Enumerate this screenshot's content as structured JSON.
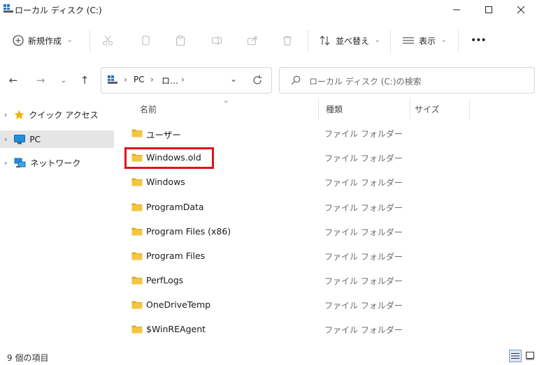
{
  "window": {
    "title": "ローカル ディスク (C:)"
  },
  "toolbar": {
    "new_label": "新規作成",
    "sort_label": "並べ替え",
    "view_label": "表示",
    "more_label": "•••"
  },
  "address": {
    "segments": [
      "PC",
      "ロ…"
    ]
  },
  "search": {
    "placeholder": "ローカル ディスク (C:)の検索"
  },
  "nav": {
    "items": [
      {
        "label": "クイック アクセス",
        "icon": "star-icon"
      },
      {
        "label": "PC",
        "icon": "pc-icon",
        "selected": true
      },
      {
        "label": "ネットワーク",
        "icon": "network-icon"
      }
    ]
  },
  "columns": {
    "name": "名前",
    "type": "種類",
    "size": "サイズ"
  },
  "files": [
    {
      "name": "ユーザー",
      "type": "ファイル フォルダー"
    },
    {
      "name": "Windows.old",
      "type": "ファイル フォルダー",
      "highlighted": true
    },
    {
      "name": "Windows",
      "type": "ファイル フォルダー"
    },
    {
      "name": "ProgramData",
      "type": "ファイル フォルダー"
    },
    {
      "name": "Program Files (x86)",
      "type": "ファイル フォルダー"
    },
    {
      "name": "Program Files",
      "type": "ファイル フォルダー"
    },
    {
      "name": "PerfLogs",
      "type": "ファイル フォルダー"
    },
    {
      "name": "OneDriveTemp",
      "type": "ファイル フォルダー"
    },
    {
      "name": "$WinREAgent",
      "type": "ファイル フォルダー"
    }
  ],
  "status": {
    "count_label": "9 個の項目"
  },
  "colors": {
    "highlight_border": "#e0131a",
    "folder": "#f4c542",
    "selected_nav": "#e5e5e5"
  }
}
